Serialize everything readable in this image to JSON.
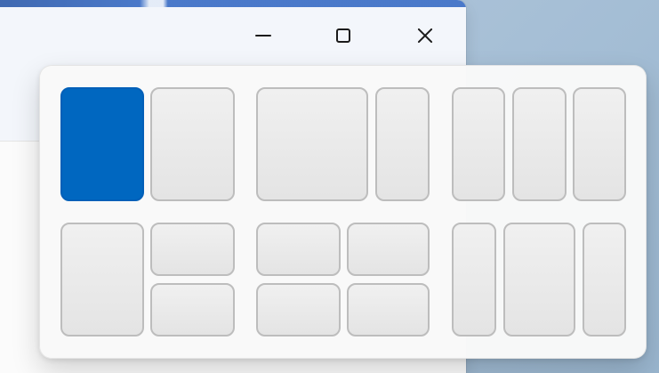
{
  "window": {
    "caption_buttons": [
      "minimize",
      "maximize",
      "close"
    ]
  },
  "snap_flyout": {
    "layouts": [
      {
        "name": "two-column-half",
        "zones": [
          {
            "icon": "zone-left-half",
            "state": "selected"
          },
          {
            "icon": "zone-right-half",
            "state": "normal"
          }
        ]
      },
      {
        "name": "two-column-wide-left",
        "zones": [
          {
            "icon": "zone-left-wide",
            "state": "normal"
          },
          {
            "icon": "zone-right-narrow",
            "state": "normal"
          }
        ]
      },
      {
        "name": "three-column-equal",
        "zones": [
          {
            "icon": "zone-left",
            "state": "normal"
          },
          {
            "icon": "zone-center",
            "state": "normal"
          },
          {
            "icon": "zone-right",
            "state": "normal"
          }
        ]
      },
      {
        "name": "left-half-right-stacked",
        "zones": [
          {
            "icon": "zone-left-tall",
            "state": "normal"
          },
          {
            "icon": "zone-right-top",
            "state": "normal"
          },
          {
            "icon": "zone-right-bottom",
            "state": "normal"
          }
        ]
      },
      {
        "name": "quadrants",
        "zones": [
          {
            "icon": "zone-top-left",
            "state": "normal"
          },
          {
            "icon": "zone-top-right",
            "state": "normal"
          },
          {
            "icon": "zone-bottom-left",
            "state": "normal"
          },
          {
            "icon": "zone-bottom-right",
            "state": "normal"
          }
        ]
      },
      {
        "name": "three-column-wide-center",
        "zones": [
          {
            "icon": "zone-left-narrow",
            "state": "normal"
          },
          {
            "icon": "zone-center-wide",
            "state": "normal"
          },
          {
            "icon": "zone-right-narrow",
            "state": "normal"
          }
        ]
      }
    ]
  },
  "colors": {
    "accent": "#0067c0",
    "tile_border": "#bdbdbd",
    "tile_fill": "#e4e4e4"
  }
}
